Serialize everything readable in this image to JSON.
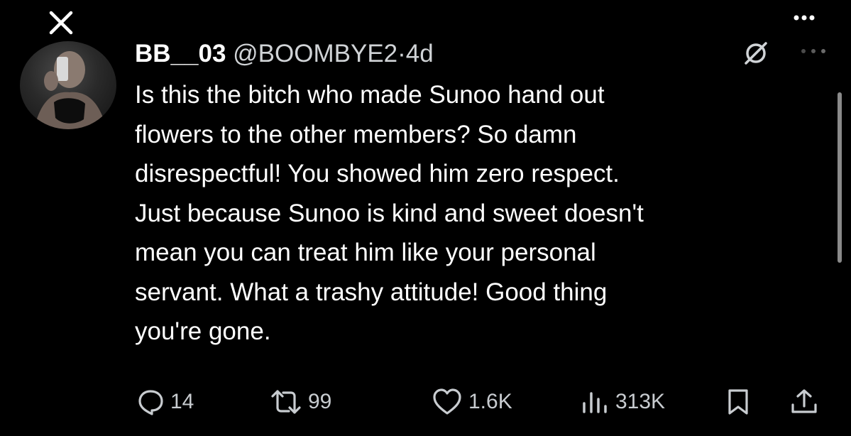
{
  "tweet": {
    "display_name": "BB__03",
    "handle": "@BOOMBYE2",
    "separator": "·",
    "time": "4d",
    "text": "Is this the bitch who made Sunoo hand out\nflowers to the other members? So damn\ndisrespectful! You showed him zero respect.\nJust because Sunoo is kind and sweet doesn't\nmean you can treat him like your personal\nservant. What a trashy attitude! Good thing\nyou're gone."
  },
  "actions": {
    "replies": "14",
    "retweets": "99",
    "likes": "1.6K",
    "views": "313K"
  },
  "icons": {
    "close": "close-icon",
    "more": "more-dots-icon",
    "grok": "grok-icon",
    "reply": "reply-icon",
    "retweet": "retweet-icon",
    "like": "heart-icon",
    "views": "views-icon",
    "bookmark": "bookmark-icon",
    "share": "share-icon"
  },
  "colors": {
    "background": "#000000",
    "text": "#ffffff",
    "secondary_text": "#c8ccd0"
  }
}
